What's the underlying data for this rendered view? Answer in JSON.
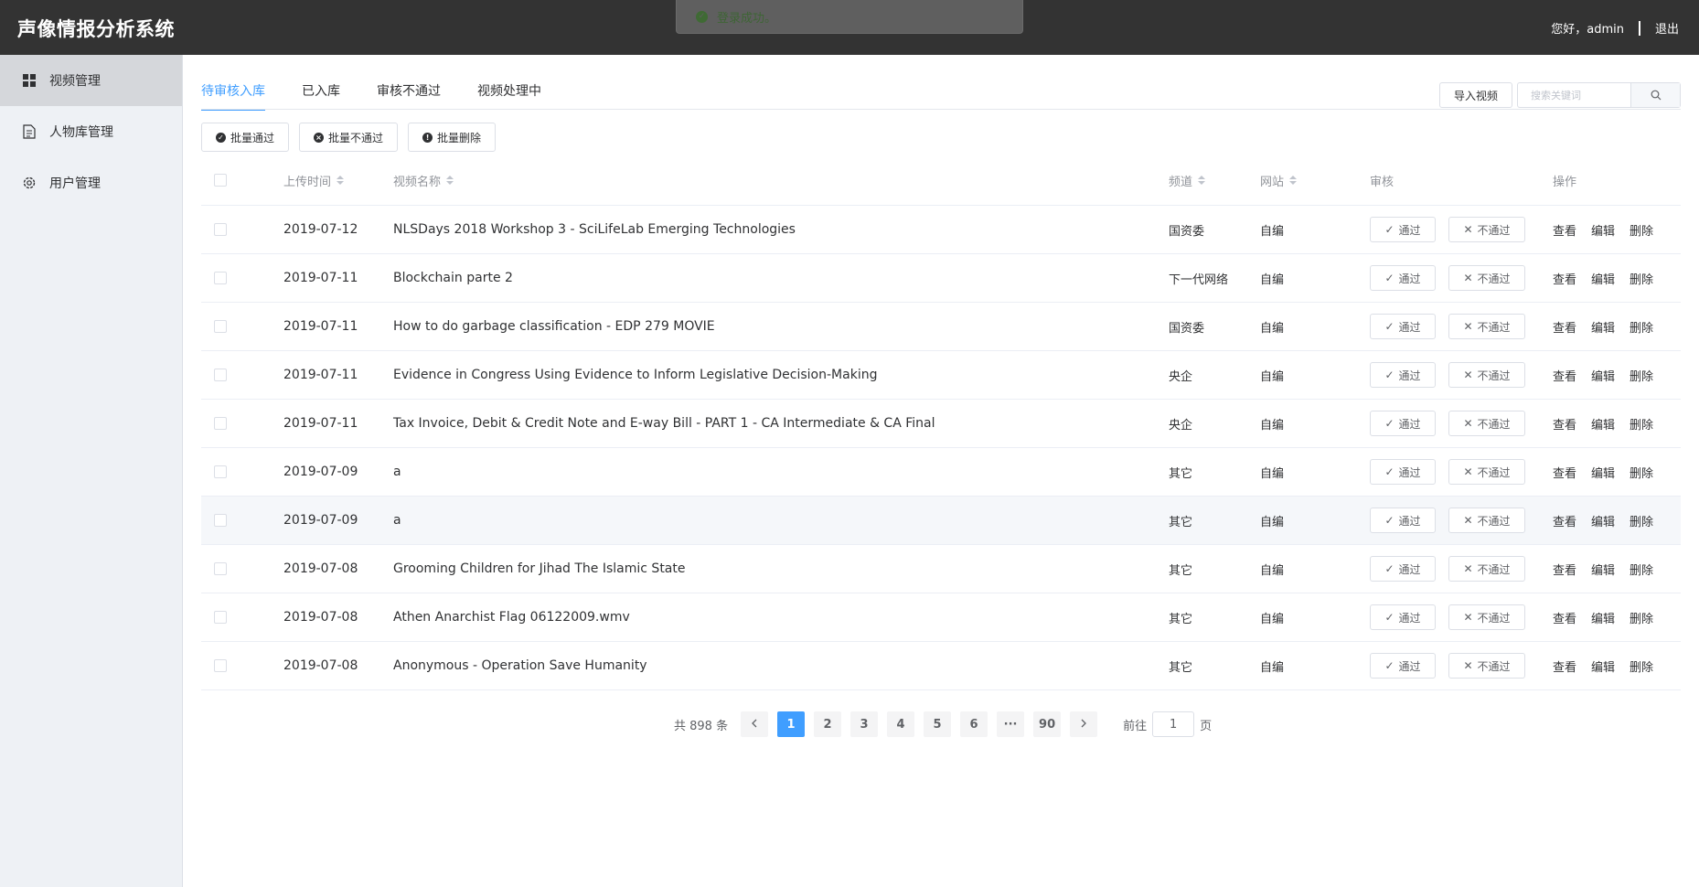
{
  "header": {
    "title": "声像情报分析系统",
    "greeting": "您好，admin",
    "logout": "退出"
  },
  "toast": {
    "message": "登录成功。",
    "icon": "check-circle-icon",
    "color": "#3e6535"
  },
  "sidebar": {
    "items": [
      {
        "label": "视频管理",
        "icon": "grid-icon",
        "active": true
      },
      {
        "label": "人物库管理",
        "icon": "document-icon",
        "active": false
      },
      {
        "label": "用户管理",
        "icon": "gear-icon",
        "active": false
      }
    ]
  },
  "tabs": [
    {
      "label": "待审核入库",
      "active": true
    },
    {
      "label": "已入库",
      "active": false
    },
    {
      "label": "审核不通过",
      "active": false
    },
    {
      "label": "视频处理中",
      "active": false
    }
  ],
  "toolbar": {
    "import_label": "导入视频",
    "search_placeholder": "搜索关键词",
    "batch_pass": "批量通过",
    "batch_fail": "批量不通过",
    "batch_delete": "批量删除"
  },
  "table": {
    "columns": {
      "upload_time": "上传时间",
      "video_name": "视频名称",
      "channel": "频道",
      "site": "网站",
      "audit": "审核",
      "actions": "操作"
    },
    "buttons": {
      "pass": "通过",
      "fail": "不通过",
      "view": "查看",
      "edit": "编辑",
      "delete": "删除"
    },
    "rows": [
      {
        "date": "2019-07-12",
        "name": "NLSDays 2018 Workshop 3 - SciLifeLab Emerging Technologies",
        "channel": "国资委",
        "site": "自编"
      },
      {
        "date": "2019-07-11",
        "name": "Blockchain parte 2",
        "channel": "下一代网络",
        "site": "自编"
      },
      {
        "date": "2019-07-11",
        "name": "How to do garbage classification - EDP 279 MOVIE",
        "channel": "国资委",
        "site": "自编"
      },
      {
        "date": "2019-07-11",
        "name": "Evidence in Congress Using Evidence to Inform Legislative Decision-Making",
        "channel": "央企",
        "site": "自编"
      },
      {
        "date": "2019-07-11",
        "name": "Tax Invoice, Debit & Credit Note and E-way Bill - PART 1 - CA Intermediate & CA Final",
        "channel": "央企",
        "site": "自编"
      },
      {
        "date": "2019-07-09",
        "name": "a",
        "channel": "其它",
        "site": "自编"
      },
      {
        "date": "2019-07-09",
        "name": "a",
        "channel": "其它",
        "site": "自编"
      },
      {
        "date": "2019-07-08",
        "name": "Grooming Children for Jihad The Islamic State",
        "channel": "其它",
        "site": "自编"
      },
      {
        "date": "2019-07-08",
        "name": "Athen Anarchist Flag 06122009.wmv",
        "channel": "其它",
        "site": "自编"
      },
      {
        "date": "2019-07-08",
        "name": "Anonymous - Operation Save Humanity",
        "channel": "其它",
        "site": "自编"
      }
    ]
  },
  "pagination": {
    "total_text": "共 898 条",
    "pages": [
      "1",
      "2",
      "3",
      "4",
      "5",
      "6",
      "···",
      "90"
    ],
    "current": "1",
    "goto_label": "前往",
    "goto_value": "1",
    "page_unit": "页"
  },
  "colors": {
    "accent": "#409eff",
    "header_bg": "#333333",
    "sidebar_bg": "#eef1f5"
  }
}
